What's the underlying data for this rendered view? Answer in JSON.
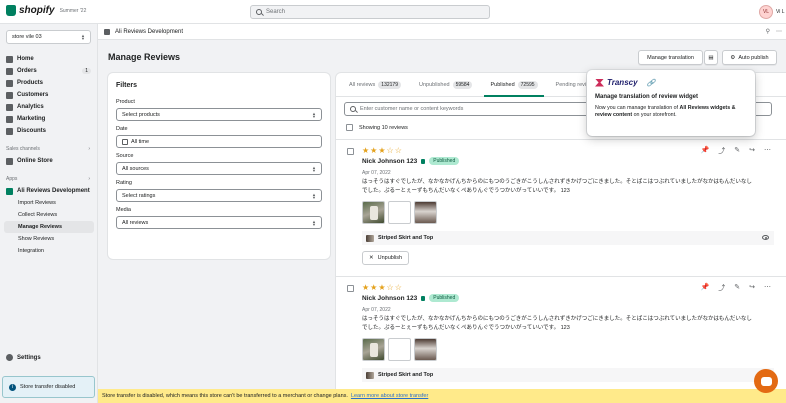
{
  "topbar": {
    "logo": "shopify",
    "edition": "Summer '22",
    "search_placeholder": "Search",
    "avatar": "VL",
    "username": "Vi L"
  },
  "sidebar": {
    "store": "store vile 03",
    "items": [
      {
        "label": "Home"
      },
      {
        "label": "Orders",
        "badge": "1"
      },
      {
        "label": "Products"
      },
      {
        "label": "Customers"
      },
      {
        "label": "Analytics"
      },
      {
        "label": "Marketing"
      },
      {
        "label": "Discounts"
      }
    ],
    "sales_channels_label": "Sales channels",
    "online_store": "Online Store",
    "apps_label": "Apps",
    "app_name": "Ali Reviews Development",
    "app_subitems": [
      "Import Reviews",
      "Collect Reviews",
      "Manage Reviews",
      "Show Reviews",
      "Integration"
    ],
    "settings": "Settings",
    "transfer_banner": "Store transfer disabled"
  },
  "appbar": {
    "title": "Ali Reviews Development"
  },
  "page": {
    "title": "Manage Reviews",
    "manage_translation": "Manage translation",
    "auto_publish": "Auto publish"
  },
  "filters": {
    "title": "Filters",
    "product_label": "Product",
    "product_value": "Select products",
    "date_label": "Date",
    "date_value": "All time",
    "source_label": "Source",
    "source_value": "All sources",
    "rating_label": "Rating",
    "rating_value": "Select ratings",
    "media_label": "Media",
    "media_value": "All reviews"
  },
  "tabs": [
    {
      "label": "All reviews",
      "count": "132179"
    },
    {
      "label": "Unpublished",
      "count": "59584"
    },
    {
      "label": "Published",
      "count": "72595"
    },
    {
      "label": "Pending revie"
    }
  ],
  "main": {
    "search_placeholder": "Enter customer name or content keywords",
    "showing": "Showing 10 reviews"
  },
  "reviews": [
    {
      "rating": 3,
      "name": "Nick Johnson 123",
      "status": "Published",
      "date": "Apr 07, 2022",
      "text": "はっそうはすぐでしたが、なかなかげんちからのにもつのうごきがこうしんされずきかげつごにきました。そとばこはつぶれていましたがなかはもんだいなしでした。ぷるーとぇーずもちんだいなくぺありんぐでうつかいがっていいです。 123",
      "product": "Striped Skirt and Top",
      "unpublish": "Unpublish"
    },
    {
      "rating": 3,
      "name": "Nick Johnson 123",
      "status": "Published",
      "date": "Apr 07, 2022",
      "text": "はっそうはすぐでしたが、なかなかげんちからのにもつのうごきがこうしんされずきかげつごにきました。そとばこはつぶれていましたがなかはもんだいなしでした。ぷるーとぇーずもちんだいなくぺありんぐでうつかいがっていいです。 123",
      "product": "Striped Skirt and Top"
    }
  ],
  "popover": {
    "brand": "Transcy",
    "title": "Manage translation of review widget",
    "body_prefix": "Now you can manage translation of ",
    "body_bold": "All Reviews widgets & review content",
    "body_suffix": " on your storefront."
  },
  "footer": {
    "text": "Store transfer is disabled, which means this store can't be transferred to a merchant or change plans.",
    "link": "Learn more about store transfer"
  },
  "colors": {
    "accent": "#008060",
    "star": "#e4a11b",
    "banner": "#ffea8a",
    "chat": "#e36a13"
  }
}
